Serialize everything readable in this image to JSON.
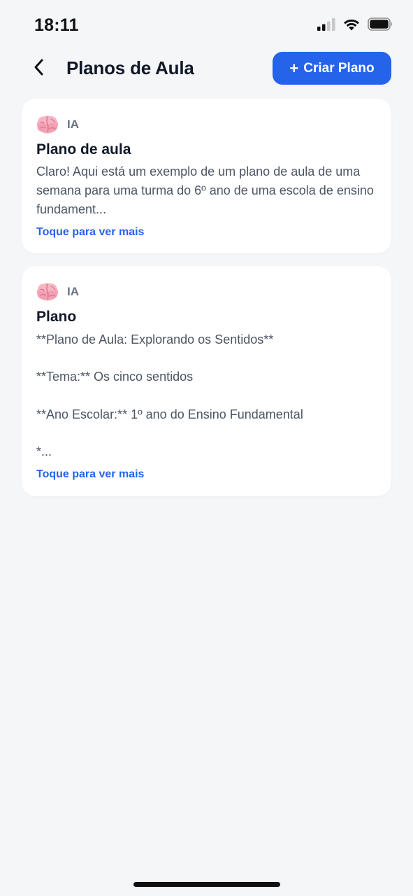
{
  "status_bar": {
    "time": "18:11",
    "icons": [
      "cellular-signal-icon",
      "wifi-icon",
      "battery-icon"
    ]
  },
  "header": {
    "title": "Planos de Aula",
    "back_icon": "chevron-left-icon",
    "create_button": {
      "icon": "+",
      "label": "Criar Plano"
    }
  },
  "plans": [
    {
      "source_icon": "brain-icon",
      "source": "IA",
      "title": "Plano de aula",
      "preview": "Claro! Aqui está um exemplo de um plano de aula de uma semana para uma turma do 6º ano de uma escola de ensino fundament...",
      "see_more": "Toque para ver mais"
    },
    {
      "source_icon": "brain-icon",
      "source": "IA",
      "title": "Plano",
      "preview": "**Plano de Aula: Explorando os Sentidos**\n\n**Tema:** Os cinco sentidos\n\n**Ano Escolar:** 1º ano do Ensino Fundamental\n\n*...",
      "see_more": "Toque para ver mais"
    }
  ],
  "colors": {
    "background": "#f5f6f8",
    "accent": "#2563eb",
    "card": "#ffffff",
    "title_text": "#111827",
    "body_text": "#4b5563",
    "muted_text": "#6b7280"
  }
}
